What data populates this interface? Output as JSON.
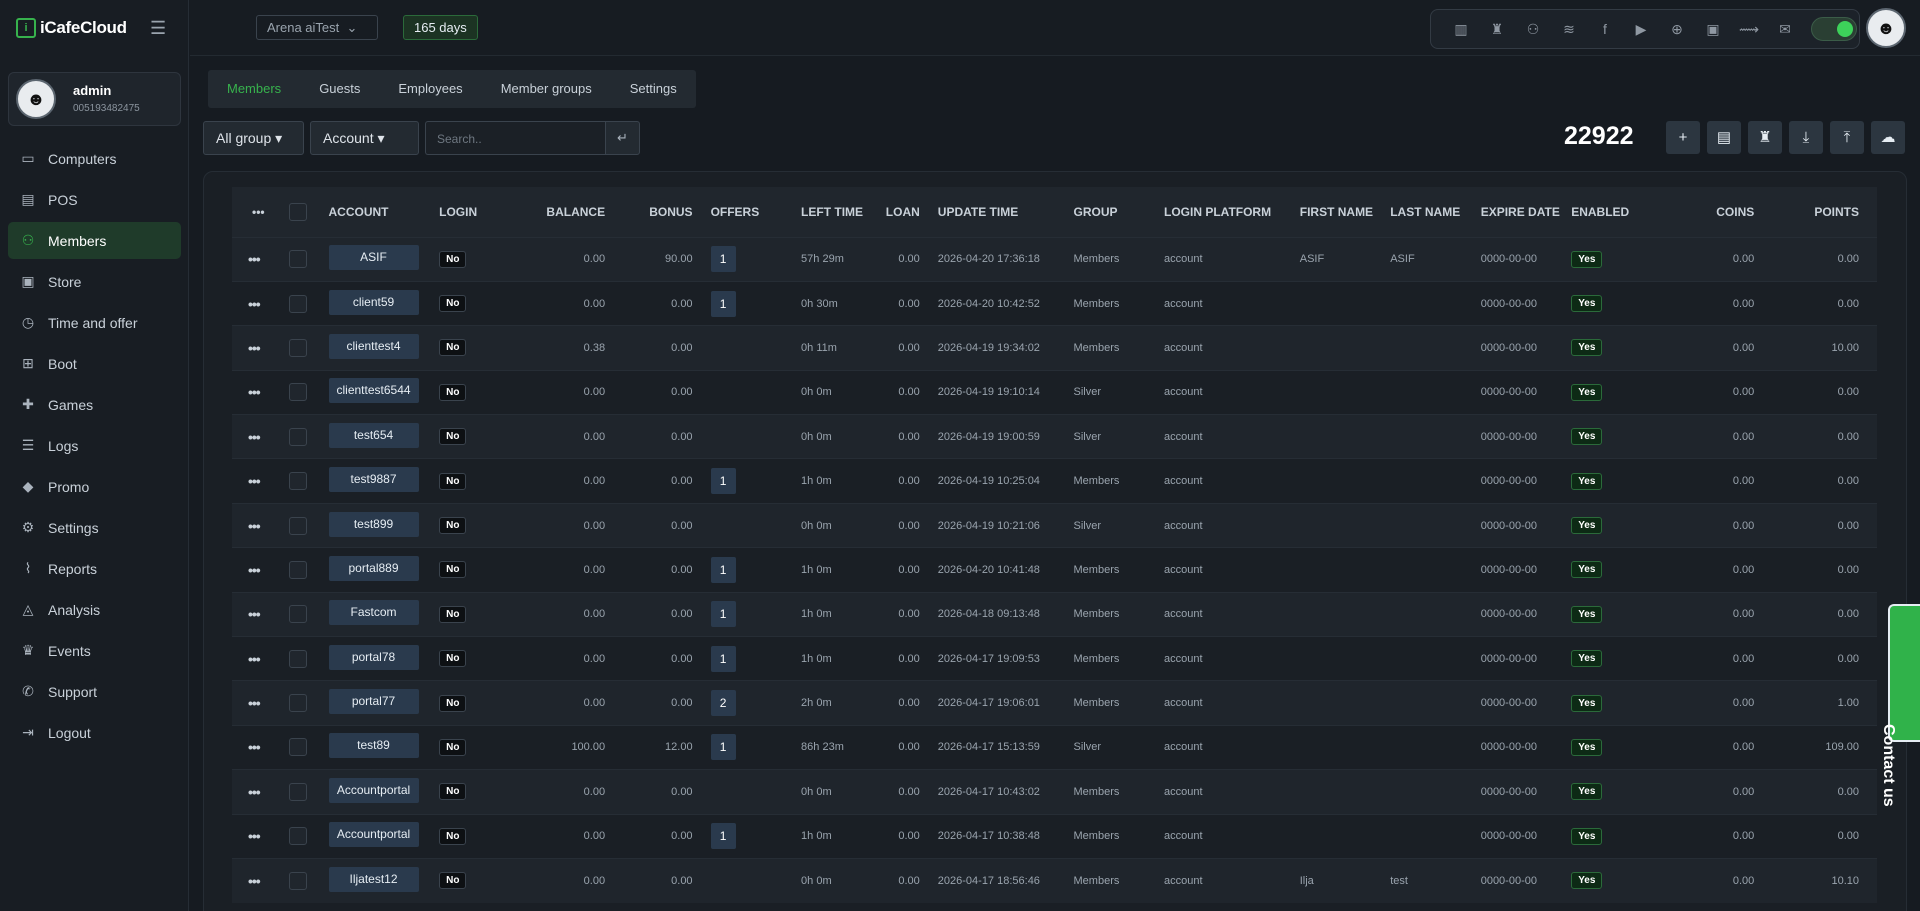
{
  "app": {
    "logo_text": "iCafeCloud"
  },
  "topbar": {
    "store": "Arena aiTest",
    "days": "165 days",
    "toolbar_icons": [
      "ranking-icon",
      "trophy-icon",
      "users-icon",
      "rss-icon",
      "facebook-icon",
      "youtube-icon",
      "globe-icon",
      "icafe-icon",
      "handshake-icon",
      "mail-icon"
    ]
  },
  "profile": {
    "name": "admin",
    "id": "005193482475"
  },
  "sidebar": {
    "items": [
      {
        "label": "Computers",
        "icon": "monitor-icon",
        "glyph": "▭"
      },
      {
        "label": "POS",
        "icon": "cash-register-icon",
        "glyph": "▤"
      },
      {
        "label": "Members",
        "icon": "members-icon",
        "glyph": "⚇"
      },
      {
        "label": "Store",
        "icon": "bag-icon",
        "glyph": "▣"
      },
      {
        "label": "Time and offer",
        "icon": "stopwatch-icon",
        "glyph": "◷"
      },
      {
        "label": "Boot",
        "icon": "windows-icon",
        "glyph": "⊞"
      },
      {
        "label": "Games",
        "icon": "gamepad-icon",
        "glyph": "✚"
      },
      {
        "label": "Logs",
        "icon": "list-icon",
        "glyph": "☰"
      },
      {
        "label": "Promo",
        "icon": "tag-icon",
        "glyph": "◆"
      },
      {
        "label": "Settings",
        "icon": "gear-icon",
        "glyph": "⚙"
      },
      {
        "label": "Reports",
        "icon": "line-chart-icon",
        "glyph": "⌇"
      },
      {
        "label": "Analysis",
        "icon": "area-chart-icon",
        "glyph": "◬"
      },
      {
        "label": "Events",
        "icon": "crown-icon",
        "glyph": "♛"
      },
      {
        "label": "Support",
        "icon": "phone-icon",
        "glyph": "✆"
      },
      {
        "label": "Logout",
        "icon": "logout-icon",
        "glyph": "⇥"
      }
    ]
  },
  "tabs": [
    "Members",
    "Guests",
    "Employees",
    "Member groups",
    "Settings"
  ],
  "filters": {
    "group": "All group",
    "field": "Account",
    "search_placeholder": "Search.."
  },
  "total": "22922",
  "actions": [
    "add-icon",
    "calculator-icon",
    "trophy-icon",
    "download-icon",
    "upload-icon",
    "cloud-upload-icon"
  ],
  "table": {
    "headers": [
      "ACCOUNT",
      "LOGIN",
      "BALANCE",
      "BONUS",
      "OFFERS",
      "LEFT TIME",
      "LOAN",
      "UPDATE TIME",
      "GROUP",
      "LOGIN PLATFORM",
      "FIRST NAME",
      "LAST NAME",
      "EXPIRE DATE",
      "ENABLED",
      "COINS",
      "POINTS"
    ],
    "rows": [
      [
        "ASIF",
        "No",
        "0.00",
        "90.00",
        "1",
        "57h 29m",
        "0.00",
        "2026-04-20 17:36:18",
        "Members",
        "account",
        "ASIF",
        "ASIF",
        "0000-00-00",
        "Yes",
        "0.00",
        "0.00"
      ],
      [
        "client59",
        "No",
        "0.00",
        "0.00",
        "1",
        "0h 30m",
        "0.00",
        "2026-04-20 10:42:52",
        "Members",
        "account",
        "",
        "",
        "0000-00-00",
        "Yes",
        "0.00",
        "0.00"
      ],
      [
        "clienttest4",
        "No",
        "0.38",
        "0.00",
        "",
        "0h 11m",
        "0.00",
        "2026-04-19 19:34:02",
        "Members",
        "account",
        "",
        "",
        "0000-00-00",
        "Yes",
        "0.00",
        "10.00"
      ],
      [
        "clienttest6544",
        "No",
        "0.00",
        "0.00",
        "",
        "0h 0m",
        "0.00",
        "2026-04-19 19:10:14",
        "Silver",
        "account",
        "",
        "",
        "0000-00-00",
        "Yes",
        "0.00",
        "0.00"
      ],
      [
        "test654",
        "No",
        "0.00",
        "0.00",
        "",
        "0h 0m",
        "0.00",
        "2026-04-19 19:00:59",
        "Silver",
        "account",
        "",
        "",
        "0000-00-00",
        "Yes",
        "0.00",
        "0.00"
      ],
      [
        "test9887",
        "No",
        "0.00",
        "0.00",
        "1",
        "1h 0m",
        "0.00",
        "2026-04-19 10:25:04",
        "Members",
        "account",
        "",
        "",
        "0000-00-00",
        "Yes",
        "0.00",
        "0.00"
      ],
      [
        "test899",
        "No",
        "0.00",
        "0.00",
        "",
        "0h 0m",
        "0.00",
        "2026-04-19 10:21:06",
        "Silver",
        "account",
        "",
        "",
        "0000-00-00",
        "Yes",
        "0.00",
        "0.00"
      ],
      [
        "portal889",
        "No",
        "0.00",
        "0.00",
        "1",
        "1h 0m",
        "0.00",
        "2026-04-20 10:41:48",
        "Members",
        "account",
        "",
        "",
        "0000-00-00",
        "Yes",
        "0.00",
        "0.00"
      ],
      [
        "Fastcom",
        "No",
        "0.00",
        "0.00",
        "1",
        "1h 0m",
        "0.00",
        "2026-04-18 09:13:48",
        "Members",
        "account",
        "",
        "",
        "0000-00-00",
        "Yes",
        "0.00",
        "0.00"
      ],
      [
        "portal78",
        "No",
        "0.00",
        "0.00",
        "1",
        "1h 0m",
        "0.00",
        "2026-04-17 19:09:53",
        "Members",
        "account",
        "",
        "",
        "0000-00-00",
        "Yes",
        "0.00",
        "0.00"
      ],
      [
        "portal77",
        "No",
        "0.00",
        "0.00",
        "2",
        "2h 0m",
        "0.00",
        "2026-04-17 19:06:01",
        "Members",
        "account",
        "",
        "",
        "0000-00-00",
        "Yes",
        "0.00",
        "1.00"
      ],
      [
        "test89",
        "No",
        "100.00",
        "12.00",
        "1",
        "86h 23m",
        "0.00",
        "2026-04-17 15:13:59",
        "Silver",
        "account",
        "",
        "",
        "0000-00-00",
        "Yes",
        "0.00",
        "109.00"
      ],
      [
        "Accountportal",
        "No",
        "0.00",
        "0.00",
        "",
        "0h 0m",
        "0.00",
        "2026-04-17 10:43:02",
        "Members",
        "account",
        "",
        "",
        "0000-00-00",
        "Yes",
        "0.00",
        "0.00"
      ],
      [
        "Accountportal",
        "No",
        "0.00",
        "0.00",
        "1",
        "1h 0m",
        "0.00",
        "2026-04-17 10:38:48",
        "Members",
        "account",
        "",
        "",
        "0000-00-00",
        "Yes",
        "0.00",
        "0.00"
      ],
      [
        "Iljatest12",
        "No",
        "0.00",
        "0.00",
        "",
        "0h 0m",
        "0.00",
        "2026-04-17 18:56:46",
        "Members",
        "account",
        "Ilja",
        "test",
        "0000-00-00",
        "Yes",
        "0.00",
        "10.10"
      ]
    ]
  },
  "contact": "Contact us",
  "colors": {
    "accent": "#37b24d",
    "bg": "#161b21"
  }
}
